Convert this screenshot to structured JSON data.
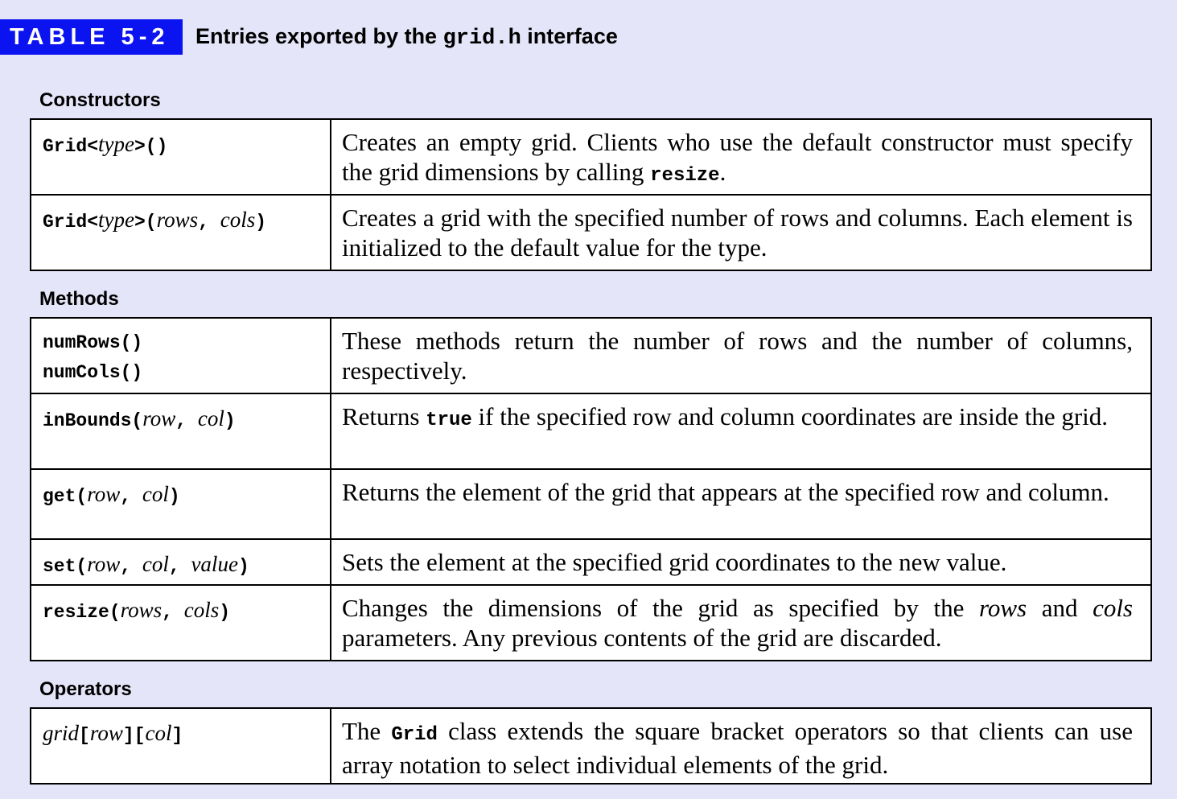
{
  "header": {
    "table_number": "TABLE 5-2",
    "title_prefix": "Entries exported by the ",
    "title_code": "grid.h",
    "title_suffix": " interface"
  },
  "sections": {
    "constructors": {
      "label": "Constructors",
      "rows": [
        {
          "sig_a": "Grid<",
          "sig_type": "type",
          "sig_b": ">()",
          "desc_a": "Creates an empty grid.  Clients who use the default constructor must specify the grid dimensions by calling ",
          "desc_code": "resize",
          "desc_b": "."
        },
        {
          "sig_a": "Grid<",
          "sig_type": "type",
          "sig_b": ">(",
          "sig_p1": "rows",
          "sig_sep": ", ",
          "sig_p2": "cols",
          "sig_c": ")",
          "desc": "Creates a grid with the specified number of rows and columns. Each element is initialized to the default value for the type."
        }
      ]
    },
    "methods": {
      "label": "Methods",
      "rows": [
        {
          "sig_line1": "numRows()",
          "sig_line2": "numCols()",
          "desc": "These methods return the number of rows and the number of columns, respectively."
        },
        {
          "sig_a": "inBounds(",
          "sig_p1": "row",
          "sig_sep": ", ",
          "sig_p2": "col",
          "sig_c": ")",
          "desc_a": "Returns ",
          "desc_code": "true",
          "desc_b": " if the specified row and column coordinates are inside the grid."
        },
        {
          "sig_a": "get(",
          "sig_p1": "row",
          "sig_sep": ", ",
          "sig_p2": "col",
          "sig_c": ")",
          "desc": "Returns the element of the grid that appears at the specified row and column."
        },
        {
          "sig_a": "set(",
          "sig_p1": "row",
          "sig_sep": ", ",
          "sig_p2": "col",
          "sig_sep2": ", ",
          "sig_p3": "value",
          "sig_c": ")",
          "desc": "Sets the element at the specified grid coordinates to the new value."
        },
        {
          "sig_a": "resize(",
          "sig_p1": "rows",
          "sig_sep": ", ",
          "sig_p2": "cols",
          "sig_c": ")",
          "desc_a": "Changes the dimensions of the grid as specified by the ",
          "desc_it1": "rows",
          "desc_mid": " and ",
          "desc_it2": "cols",
          "desc_b": " parameters.  Any previous contents of the grid are discarded."
        }
      ]
    },
    "operators": {
      "label": "Operators",
      "rows": [
        {
          "sig_grid": "grid",
          "sig_ob1": "[",
          "sig_p1": "row",
          "sig_cb1": "]",
          "sig_ob2": "[",
          "sig_p2": "col",
          "sig_cb2": "]",
          "desc_a": "The ",
          "desc_code": "Grid",
          "desc_b": " class extends the square bracket operators so that clients can use array notation to select individual elements of the grid."
        }
      ]
    }
  }
}
